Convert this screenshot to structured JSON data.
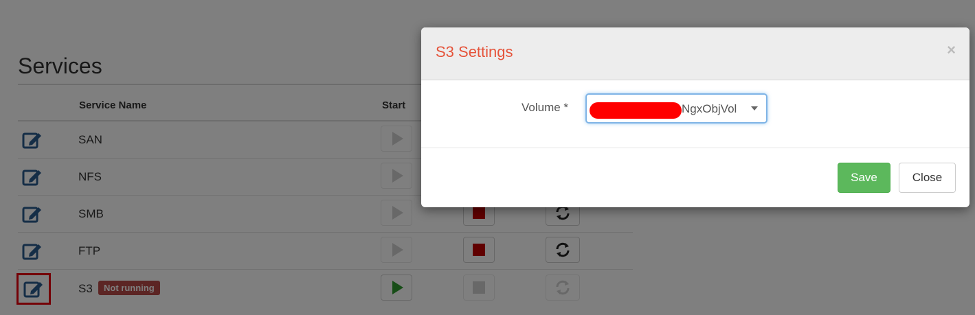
{
  "page": {
    "title": "Services",
    "columns": {
      "service_name": "Service Name",
      "start": "Start"
    },
    "services": [
      {
        "name": "SAN",
        "status": ""
      },
      {
        "name": "NFS",
        "status": ""
      },
      {
        "name": "SMB",
        "status": ""
      },
      {
        "name": "FTP",
        "status": ""
      },
      {
        "name": "S3",
        "status": "Not running"
      }
    ]
  },
  "modal": {
    "title": "S3 Settings",
    "close_symbol": "×",
    "volume_label": "Volume *",
    "volume_value": "NgxObjVol",
    "save_label": "Save",
    "close_label": "Close"
  },
  "colors": {
    "modal_title": "#e5533a",
    "save_button": "#5cb85c",
    "status_badge": "#b94a48",
    "stop_button": "#c00000",
    "start_button_active": "#2f9a2f",
    "highlight_box": "#e8000c"
  },
  "icons": {
    "edit": "edit-icon",
    "start": "play-icon",
    "stop": "stop-icon",
    "restart": "refresh-icon",
    "dropdown": "caret-down-icon",
    "close": "close-icon"
  }
}
